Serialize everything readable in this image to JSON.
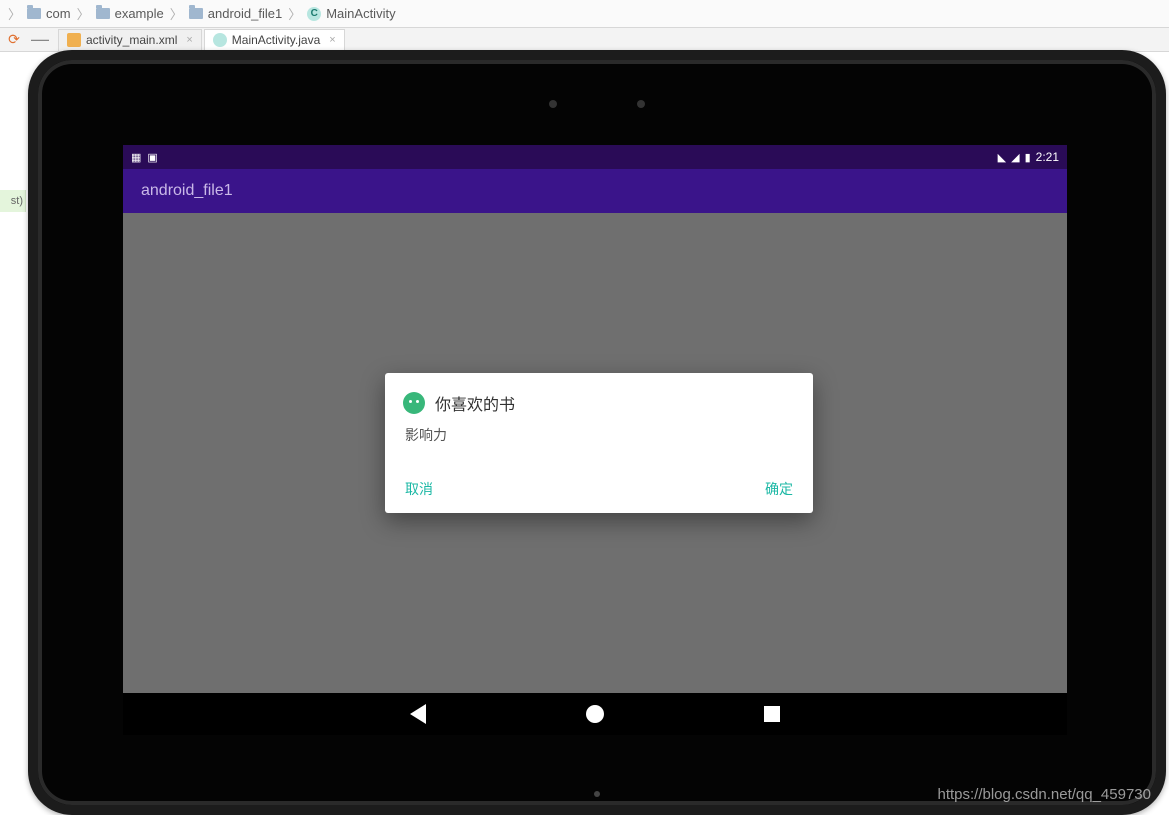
{
  "breadcrumb": {
    "item1": "com",
    "item2": "example",
    "item3": "android_file1",
    "item4": "MainActivity",
    "class_letter": "C"
  },
  "tabs": {
    "tab1": "activity_main.xml",
    "tab2": "MainActivity.java"
  },
  "gutter": {
    "text": "st)"
  },
  "status": {
    "time": "2:21"
  },
  "app_bar": {
    "title": "android_file1"
  },
  "dialog": {
    "title": "你喜欢的书",
    "message": "影响力",
    "cancel": "取消",
    "ok": "确定"
  },
  "watermark": "https://blog.csdn.net/qq_459730"
}
